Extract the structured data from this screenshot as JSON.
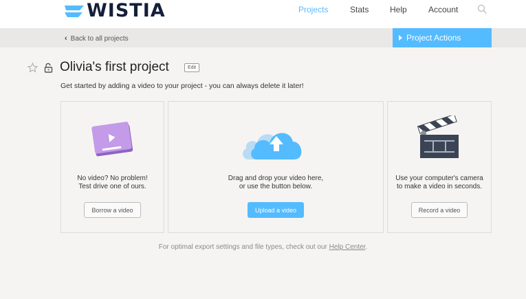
{
  "header": {
    "logo_text": "WISTIA",
    "nav": [
      {
        "label": "Projects",
        "active": true
      },
      {
        "label": "Stats",
        "active": false
      },
      {
        "label": "Help",
        "active": false
      },
      {
        "label": "Account",
        "active": false
      }
    ],
    "accent_color": "#54bbff",
    "logo_color": "#151f3a"
  },
  "subbar": {
    "back_label": "Back to all projects",
    "actions_label": "Project Actions"
  },
  "project": {
    "title": "Olivia's first project",
    "edit_label": "Edit",
    "subtitle": "Get started by adding a video to your project - you can always delete it later!"
  },
  "cards": {
    "borrow": {
      "line1": "No video? No problem!",
      "line2": "Test drive one of ours.",
      "button": "Borrow a video"
    },
    "upload": {
      "line1": "Drag and drop your video here,",
      "line2": "or use the button below.",
      "button": "Upload a video"
    },
    "record": {
      "line1": "Use your computer's camera",
      "line2": "to make a video in seconds.",
      "button": "Record a video"
    }
  },
  "footer": {
    "text_before": "For optimal export settings and file types, check out our ",
    "link": "Help Center",
    "text_after": "."
  }
}
